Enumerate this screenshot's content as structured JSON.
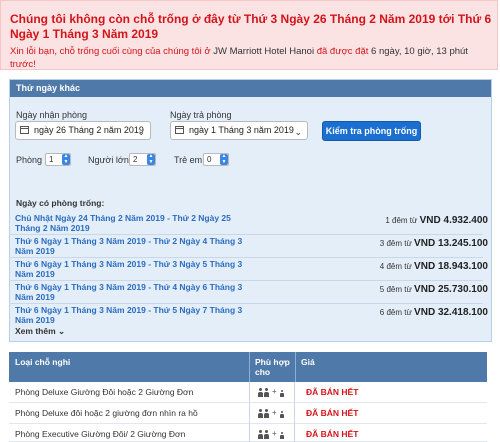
{
  "alert": {
    "title": "Chúng tôi không còn chỗ trống ở đây từ Thứ 3 Ngày 26 Tháng 2 Năm 2019 tới Thứ 6 Ngày 1 Tháng 3 Năm 2019",
    "msg_prefix": "Xin lỗi bạn, chỗ trống cuối cùng của chúng tôi ở",
    "hotel": "JW Marriott Hotel Hanoi",
    "msg_mid": "đã được đặt",
    "duration": "6 ngày, 10 giờ, 13 phút",
    "msg_suffix": "trước!"
  },
  "panel": {
    "title": "Thử ngày khác",
    "checkin_label": "Ngày nhận phòng",
    "checkin_value": "ngày 26 Tháng 2 năm 2019",
    "checkout_label": "Ngày trả phòng",
    "checkout_value": "ngày 1 Tháng 3 năm 2019",
    "search_button": "Kiểm tra phòng trống",
    "rooms_label": "Phòng",
    "rooms_value": "1",
    "adults_label": "Người lớn",
    "adults_value": "2",
    "children_label": "Trẻ em",
    "children_value": "0",
    "available_heading": "Ngày có phòng trống:",
    "see_more": "Xem thêm",
    "availability": [
      {
        "dates": "Chủ Nhật Ngày 24 Tháng 2 Năm 2019 - Thứ 2 Ngày 25 Tháng 2 Năm 2019",
        "nights": "1 đêm từ",
        "price": "VND 4.932.400"
      },
      {
        "dates": "Thứ 6 Ngày 1 Tháng 3 Năm 2019 - Thứ 2 Ngày 4 Tháng 3 Năm 2019",
        "nights": "3 đêm từ",
        "price": "VND 13.245.100"
      },
      {
        "dates": "Thứ 6 Ngày 1 Tháng 3 Năm 2019 - Thứ 3 Ngày 5 Tháng 3 Năm 2019",
        "nights": "4 đêm từ",
        "price": "VND 18.943.100"
      },
      {
        "dates": "Thứ 6 Ngày 1 Tháng 3 Năm 2019 - Thứ 4 Ngày 6 Tháng 3 Năm 2019",
        "nights": "5 đêm từ",
        "price": "VND 25.730.100"
      },
      {
        "dates": "Thứ 6 Ngày 1 Tháng 3 Năm 2019 - Thứ 5 Ngày 7 Tháng 3 Năm 2019",
        "nights": "6 đêm từ",
        "price": "VND 32.418.100"
      }
    ]
  },
  "table": {
    "col_room": "Loại chỗ nghỉ",
    "col_fit": "Phù hợp cho",
    "col_price": "Giá",
    "rows": [
      {
        "name": "Phòng Deluxe Giường Đôi hoặc 2 Giường Đơn",
        "price": "ĐÃ BÁN HẾT"
      },
      {
        "name": "Phòng Deluxe đôi hoặc 2 giường đơn nhìn ra hồ",
        "price": "ĐÃ BÁN HẾT"
      },
      {
        "name": "Phòng Executive Giường Đôi/ 2 Giường Đơn",
        "price": "ĐÃ BÁN HẾT"
      }
    ]
  },
  "colors": {
    "alert_text": "#d3141a",
    "alert_bg": "#fbe3e4",
    "panel_header": "#4f79a8",
    "panel_bg": "#e4eef9",
    "link": "#2a6cc0",
    "button": "#1a6fd0"
  },
  "icons": [
    "calendar-icon",
    "chevron-down-icon",
    "stepper-icon",
    "adult-icon",
    "child-icon"
  ]
}
